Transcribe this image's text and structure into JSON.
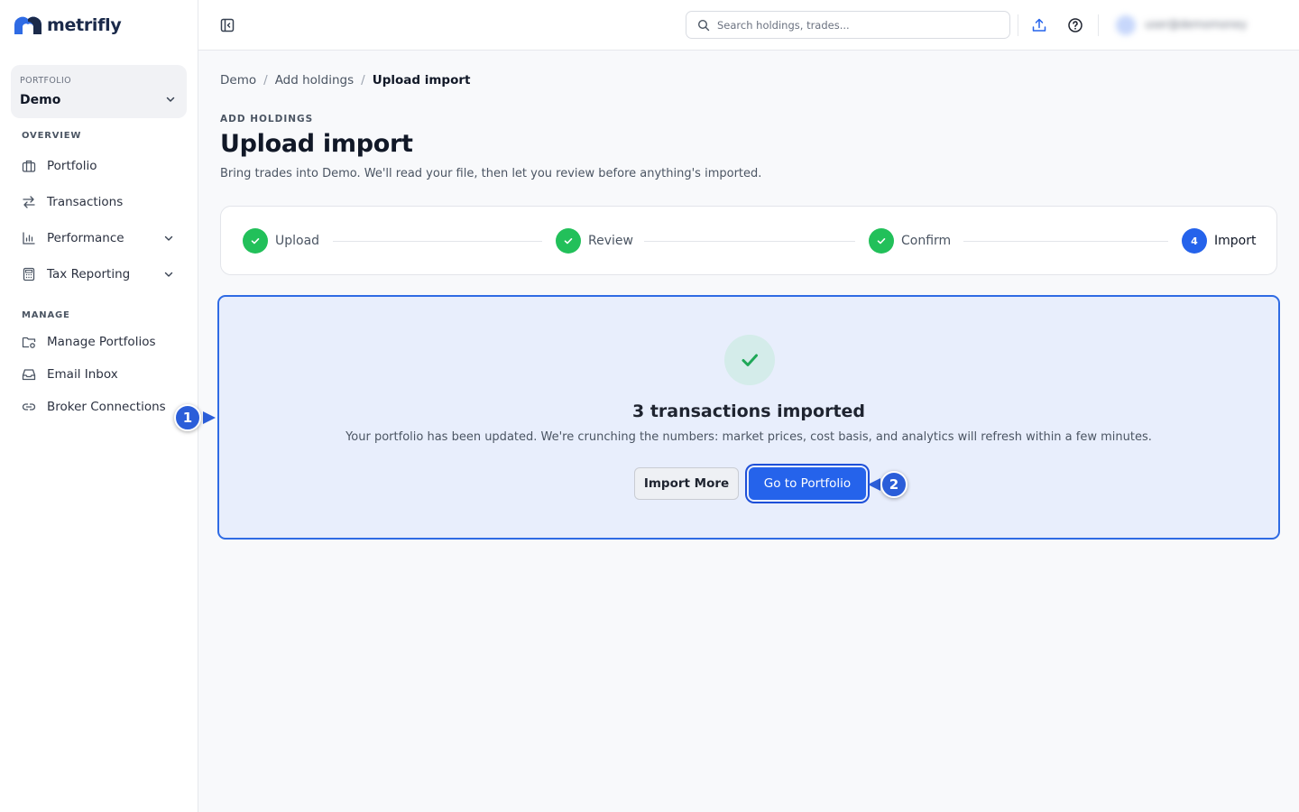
{
  "app": {
    "name": "metrifly"
  },
  "sidebar": {
    "portfolio_label": "PORTFOLIO",
    "portfolio_value": "Demo",
    "overview_label": "OVERVIEW",
    "manage_label": "MANAGE",
    "overview_items": [
      {
        "label": "Portfolio",
        "icon": "briefcase-icon"
      },
      {
        "label": "Transactions",
        "icon": "swap-arrows-icon"
      },
      {
        "label": "Performance",
        "icon": "bar-chart-icon",
        "expandable": true
      },
      {
        "label": "Tax Reporting",
        "icon": "calculator-icon",
        "expandable": true
      }
    ],
    "manage_items": [
      {
        "label": "Manage Portfolios",
        "icon": "folder-gear-icon"
      },
      {
        "label": "Email Inbox",
        "icon": "inbox-icon"
      },
      {
        "label": "Broker Connections",
        "icon": "link-icon"
      }
    ]
  },
  "topbar": {
    "search_placeholder": "Search holdings, trades...",
    "user_name": "user@demomoney"
  },
  "breadcrumb": [
    "Demo",
    "Add holdings",
    "Upload import"
  ],
  "header": {
    "eyebrow": "ADD HOLDINGS",
    "title": "Upload import",
    "subtitle": "Bring trades into Demo. We'll read your file, then let you review before anything's imported."
  },
  "stepper": {
    "steps": [
      {
        "label": "Upload",
        "state": "done"
      },
      {
        "label": "Review",
        "state": "done"
      },
      {
        "label": "Confirm",
        "state": "done"
      },
      {
        "label": "Import",
        "state": "active",
        "number": "4"
      }
    ]
  },
  "result": {
    "title": "3 transactions imported",
    "description": "Your portfolio has been updated. We're crunching the numbers: market prices, cost basis, and analytics will refresh within a few minutes.",
    "secondary_button": "Import More",
    "primary_button": "Go to Portfolio"
  },
  "callouts": [
    "1",
    "2"
  ],
  "colors": {
    "accent": "#2563eb",
    "success": "#22c05a",
    "callout": "#2b5ed9"
  }
}
